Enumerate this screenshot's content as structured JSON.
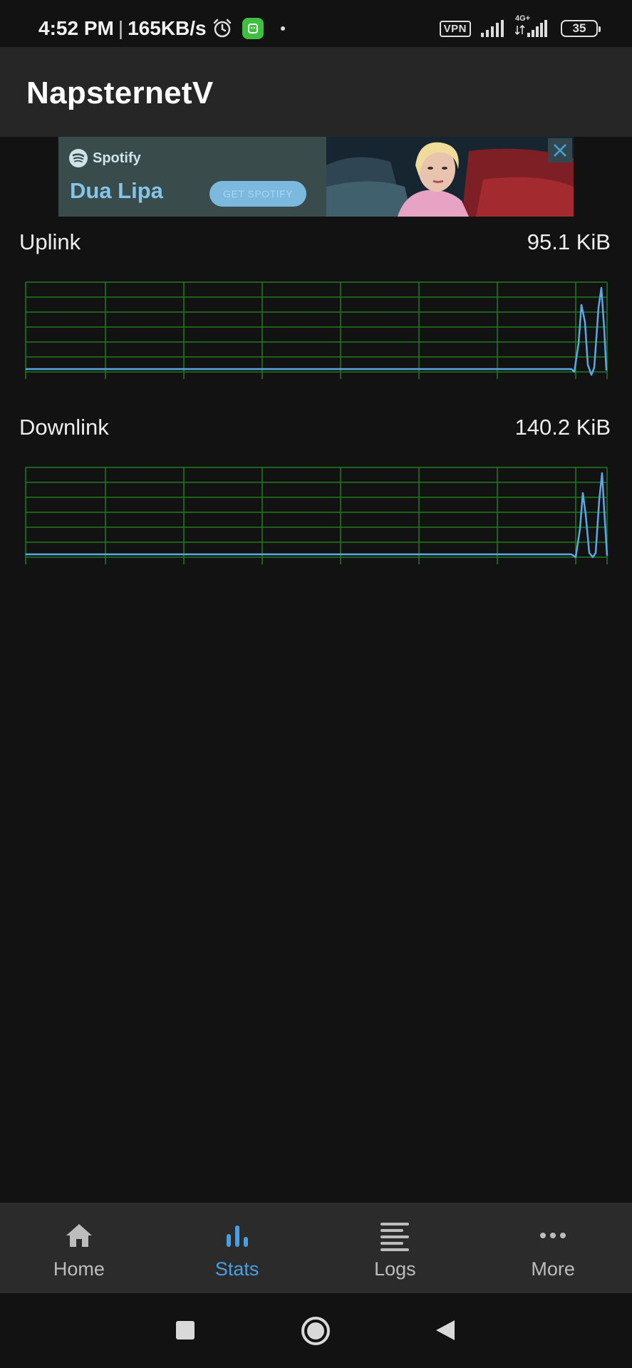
{
  "status_bar": {
    "time": "4:52 PM",
    "separator": "|",
    "speed": "165KB/s",
    "vpn_label": "VPN",
    "network_label": "4G+",
    "battery": "35"
  },
  "app_bar": {
    "title": "NapsternetV"
  },
  "ad": {
    "brand": "Spotify",
    "headline": "Dua Lipa",
    "cta": "GET SPOTIFY"
  },
  "stats": {
    "uplink": {
      "label": "Uplink",
      "value": "95.1 KiB"
    },
    "downlink": {
      "label": "Downlink",
      "value": "140.2 KiB"
    }
  },
  "bottom_nav": {
    "items": [
      {
        "label": "Home",
        "icon": "home-icon",
        "active": false
      },
      {
        "label": "Stats",
        "icon": "bar-chart-icon",
        "active": true
      },
      {
        "label": "Logs",
        "icon": "logs-icon",
        "active": false
      },
      {
        "label": "More",
        "icon": "more-icon",
        "active": false
      }
    ]
  },
  "colors": {
    "accent": "#4a9fe3",
    "grid": "#1f7a1f",
    "line": "#5aa9e6",
    "background": "#121212",
    "app_bar": "#262626",
    "bottom_nav": "#2b2b2b"
  }
}
